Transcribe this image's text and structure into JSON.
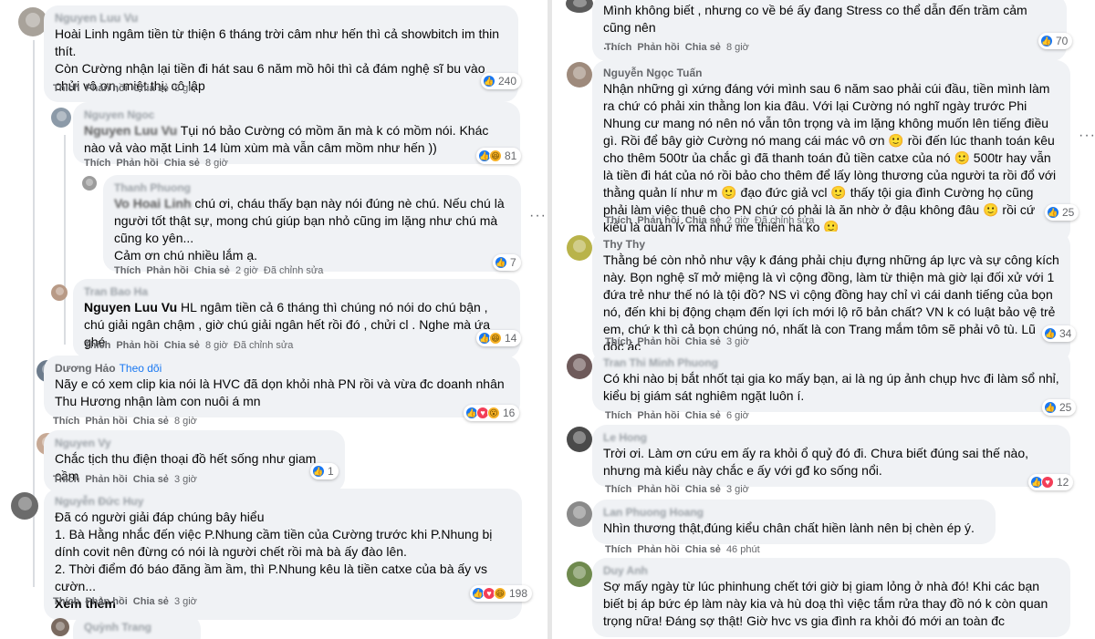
{
  "left": {
    "comments": [
      {
        "author": "Nguyen Luu Vu",
        "text": "Hoài Linh ngâm tiền từ thiện 6 tháng trời câm như hến thì cả showbitch im thin thít.\nCòn Cường nhận lại tiền đi hát sau 6 năm mồ hôi thì cả đám nghệ sĩ bu vào chửi vô ơn, miệt thị, cô lập",
        "like": "Thích",
        "reply": "Phản hồi",
        "share": "Chia sẻ",
        "time": "8 giờ",
        "count": "240"
      },
      {
        "author": "Nguyen Ngoc",
        "tag": "Nguyen Luu Vu",
        "text": "Tụi nó bảo Cường có mồm ăn mà k có mồm nói. Khác nào vả vào mặt Linh 14 lùm xùm mà vẫn câm mồm như hến ))",
        "like": "Thích",
        "reply": "Phản hồi",
        "share": "Chia sẻ",
        "time": "8 giờ",
        "count": "81"
      },
      {
        "author": "Thanh Phuong",
        "tag": "Vo Hoai Linh",
        "text": "chú ơi, cháu thấy bạn này nói đúng nè chú. Nếu chú là người tốt thật sự, mong chú giúp bạn nhỏ cũng im lặng như chú mà cũng ko yên...\nCảm ơn chú nhiều lắm ạ.",
        "like": "Thích",
        "reply": "Phản hồi",
        "share": "Chia sẻ",
        "time": "2 giờ",
        "edited": "Đã chỉnh sửa",
        "count": "7"
      },
      {
        "author": "Tran Bao Ha",
        "tag": "Nguyen Luu Vu",
        "text": "HL ngâm tiền cả 6 tháng thì chúng nó nói do chú bận , chú giải ngân chậm , giờ chú giải ngân hết rồi đó , chửi cl . Nghe mà ứa ghé",
        "like": "Thích",
        "reply": "Phản hồi",
        "share": "Chia sẻ",
        "time": "8 giờ",
        "edited": "Đã chỉnh sửa",
        "count": "14"
      },
      {
        "author": "Dương Hảo",
        "follow": "Theo dõi",
        "text": "Nãy e có xem clip kia nói là HVC đã dọn khỏi nhà PN rồi và vừa đc doanh nhân Thu Hương nhận làm con nuôi á mn",
        "like": "Thích",
        "reply": "Phản hồi",
        "share": "Chia sẻ",
        "time": "8 giờ",
        "count": "16"
      },
      {
        "author": "Nguyen Vy",
        "text": "Chắc tịch thu điện thoại đồ hết sống như giam cầm",
        "like": "Thích",
        "reply": "Phản hồi",
        "share": "Chia sẻ",
        "time": "3 giờ",
        "count": "1"
      },
      {
        "author": "Nguyễn Đức Huy",
        "text": "Đã có người giải đáp chúng bây hiểu\n1. Bà Hằng nhắc đến việc P.Nhung cầm tiền của Cường trước khi P.Nhung bị dính covit nên đừng có nói là người chết rồi mà bà ấy đào lên.\n2. Thời điểm đó báo đăng ầm ầm, thì P.Nhung kêu là tiền catxe của bà ấy vs cườn...",
        "more": "Xem thêm",
        "like": "Thích",
        "reply": "Phản hồi",
        "share": "Chia sẻ",
        "time": "3 giờ",
        "count": "198"
      },
      {
        "author": "Quỳnh Trang"
      }
    ]
  },
  "right": {
    "comments": [
      {
        "text": "Mình không biết , nhưng co về bé ấy đang Stress co thể dẫn đến trầm cảm cũng nên\n...",
        "like": "Thích",
        "reply": "Phản hồi",
        "share": "Chia sẻ",
        "time": "8 giờ",
        "count": "70"
      },
      {
        "author": "Nguyễn Ngọc Tuấn",
        "text": "Nhận những gì xứng đáng với mình sau 6 năm sao phải cúi đầu, tiền mình làm ra chứ có phải xin thằng lon kia đâu. Với lại Cường nó nghĩ ngày trước Phi Nhung cư mang nó nên nó vẫn tôn trọng và im lặng không muốn lên tiếng điều gì. Rồi để bây giờ Cường nó mang cái mác vô ơn 🙂 rồi đến lúc thanh toán kêu cho thêm 500tr ủa chắc gì đã thanh toán đủ tiền catxe của nó 🙂 500tr hay vẫn là tiền đi hát của nó rồi bảo cho thêm để lấy lòng thương của người ta rồi đổ với thằng quản lí như m 🙂 đạo đức giả vcl 🙂 thấy tội gia đình Cường họ cũng phải làm việc thuê cho PN chứ có phải là ăn nhờ ở đậu không đâu 🙂 rồi cứ kiểu là quản lý mà như mẹ thiên hạ ko 🙂",
        "like": "Thích",
        "reply": "Phản hồi",
        "share": "Chia sẻ",
        "time": "2 giờ",
        "edited": "Đã chỉnh sửa",
        "count": "25"
      },
      {
        "author": "Thy Thy",
        "text": "Thằng bé còn nhỏ như vậy k đáng phải chịu đựng những áp lực và sự công kích này. Bọn nghệ sĩ mở miệng là vì cộng đồng, làm từ thiện mà giờ lại đối xử với 1 đứa trẻ như thế nó là tội đồ? NS vì cộng đồng hay chỉ vì cái danh tiếng của bọn nó, đến khi bị động chạm đến lợi ích mới lộ rõ bản chất? VN k có luật bảo vệ trẻ em, chứ k thì cả bọn chúng nó, nhất là con Trang mắm tôm sẽ phải vô tù. Lũ độc ác",
        "like": "Thích",
        "reply": "Phản hồi",
        "share": "Chia sẻ",
        "time": "3 giờ",
        "count": "34"
      },
      {
        "author": "Tran Thi Minh Phuong",
        "text": "Có khi nào bị bắt nhốt tại gia ko mấy bạn, ai là ng úp ảnh chụp hvc đi làm sổ nhỉ, kiểu bị giám sát nghiêm ngặt luôn í.",
        "like": "Thích",
        "reply": "Phản hồi",
        "share": "Chia sẻ",
        "time": "6 giờ",
        "count": "25"
      },
      {
        "author": "Le Hong",
        "text": "Trời ơi. Làm ơn cứu em ấy ra khỏi ổ quỷ đó đi. Chưa biết đúng sai thế nào, nhưng mà kiểu này chắc e ấy với gđ ko sống nổi.",
        "like": "Thích",
        "reply": "Phản hồi",
        "share": "Chia sẻ",
        "time": "3 giờ",
        "count": "12"
      },
      {
        "author": "Lan Phuong Hoang",
        "text": "Nhìn thương thật,đúng kiểu chân chất hiền lành nên bị chèn ép ý.",
        "like": "Thích",
        "reply": "Phản hồi",
        "share": "Chia sẻ",
        "time": "46 phút"
      },
      {
        "author": "Duy Anh",
        "text": "Sợ mấy ngày từ lúc phinhung chết tới giờ bị giam lỏng ở nhà đó! Khi các bạn biết bị áp bức ép làm này kia và hù doạ thì việc tắm rửa thay đồ nó k còn quan trọng nữa! Đáng sợ thật! Giờ hvc vs gia đình ra khỏi đó mới an toàn đc"
      }
    ]
  },
  "colors": {
    "bubble": "#f0f2f5",
    "meta": "#65676b",
    "like": "#1877f2",
    "love": "#f33e58",
    "haha": "#f7b125",
    "link": "#1877f2"
  }
}
